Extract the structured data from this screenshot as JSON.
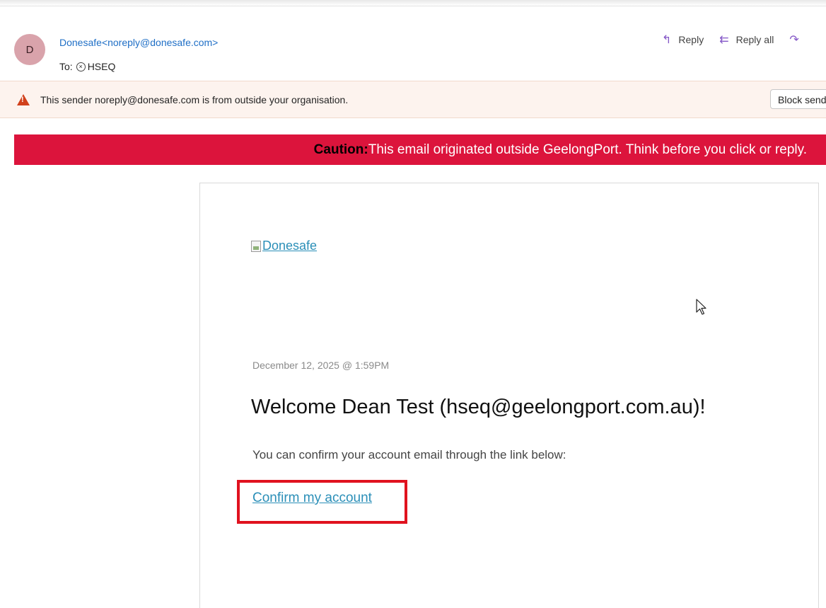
{
  "email": {
    "avatar_initial": "D",
    "sender_name": "Donesafe",
    "sender_address": "<noreply@donesafe.com>",
    "to_label": "To:",
    "recipient": "HSEQ",
    "actions": {
      "reply": "Reply",
      "reply_all": "Reply all"
    }
  },
  "warning": {
    "text": "This sender noreply@donesafe.com is from outside your organisation.",
    "block_button": "Block sender"
  },
  "caution": {
    "label": "Caution:",
    "text": "This email originated outside GeelongPort. Think before you click or reply."
  },
  "body": {
    "logo_alt": "Donesafe",
    "date": "December 12, 2025 @ 1:59PM",
    "welcome": "Welcome Dean Test (hseq@geelongport.com.au)!",
    "instruction": "You can confirm your account email through the link below:",
    "confirm_link": "Confirm my account"
  },
  "colors": {
    "caution_bg": "#dc143c",
    "link": "#2b8fb8",
    "highlight_box": "#e0121f",
    "sender": "#1f6fc6"
  }
}
